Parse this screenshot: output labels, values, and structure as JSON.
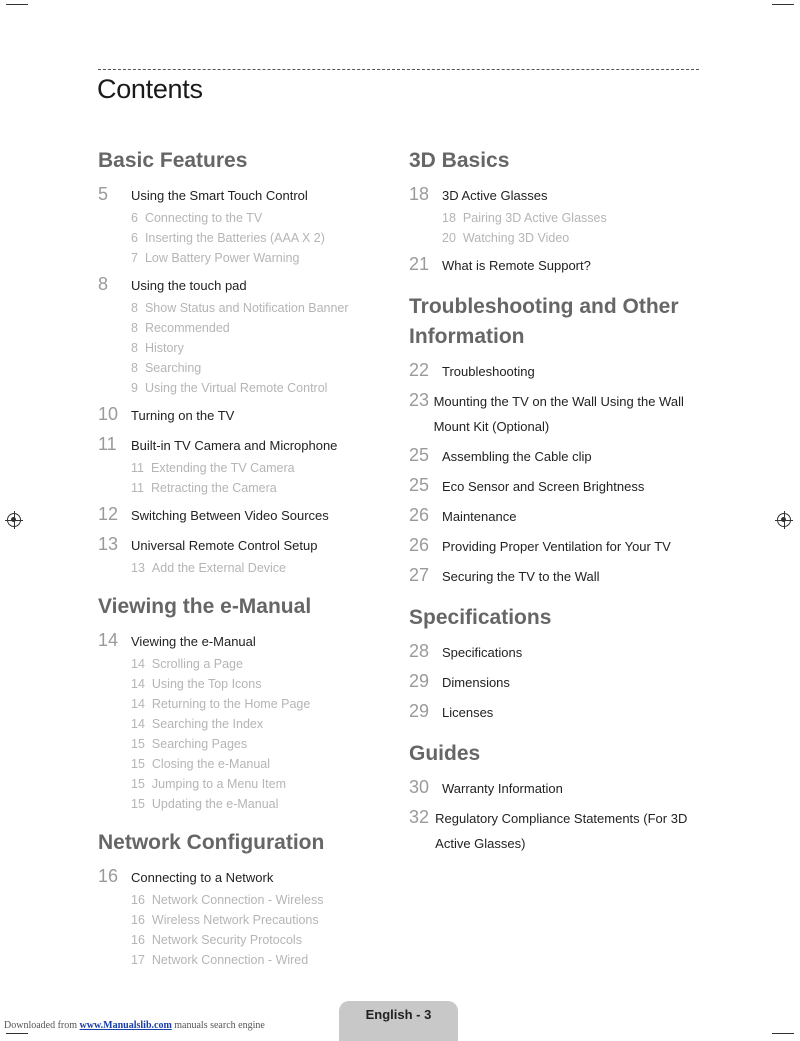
{
  "page": {
    "title": "Contents",
    "footer": {
      "downloaded_prefix": "Downloaded from",
      "link_text": "www.Manualslib.com",
      "suffix": "manuals search engine",
      "page_label": "English - 3"
    }
  },
  "left": [
    {
      "heading": "Basic Features",
      "entries": [
        {
          "num": "5",
          "label": "Using the Smart Touch Control",
          "subs": [
            {
              "num": "6",
              "label": "Connecting to the TV"
            },
            {
              "num": "6",
              "label": "Inserting the Batteries (AAA X 2)"
            },
            {
              "num": "7",
              "label": "Low Battery Power Warning"
            }
          ]
        },
        {
          "num": "8",
          "label": "Using the touch pad",
          "subs": [
            {
              "num": "8",
              "label": "Show Status and Notification Banner"
            },
            {
              "num": "8",
              "label": "Recommended"
            },
            {
              "num": "8",
              "label": "History"
            },
            {
              "num": "8",
              "label": "Searching"
            },
            {
              "num": "9",
              "label": "Using the Virtual Remote Control"
            }
          ]
        },
        {
          "num": "10",
          "label": "Turning on the TV",
          "subs": []
        },
        {
          "num": "11",
          "label": "Built-in TV Camera and Microphone",
          "subs": [
            {
              "num": "11",
              "label": "Extending the TV Camera"
            },
            {
              "num": "11",
              "label": "Retracting the Camera"
            }
          ]
        },
        {
          "num": "12",
          "label": "Switching Between Video Sources",
          "subs": []
        },
        {
          "num": "13",
          "label": "Universal Remote Control Setup",
          "subs": [
            {
              "num": "13",
              "label": "Add the External Device"
            }
          ]
        }
      ]
    },
    {
      "heading": "Viewing the e-Manual",
      "entries": [
        {
          "num": "14",
          "label": "Viewing the e-Manual",
          "subs": [
            {
              "num": "14",
              "label": "Scrolling a Page"
            },
            {
              "num": "14",
              "label": "Using the Top Icons"
            },
            {
              "num": "14",
              "label": "Returning to the Home Page"
            },
            {
              "num": "14",
              "label": "Searching the Index"
            },
            {
              "num": "15",
              "label": "Searching Pages"
            },
            {
              "num": "15",
              "label": "Closing the e-Manual"
            },
            {
              "num": "15",
              "label": "Jumping to a Menu Item"
            },
            {
              "num": "15",
              "label": "Updating the e-Manual"
            }
          ]
        }
      ]
    },
    {
      "heading": "Network Configuration",
      "entries": [
        {
          "num": "16",
          "label": "Connecting to a Network",
          "subs": [
            {
              "num": "16",
              "label": "Network Connection - Wireless"
            },
            {
              "num": "16",
              "label": "Wireless Network Precautions"
            },
            {
              "num": "16",
              "label": "Network Security Protocols"
            },
            {
              "num": "17",
              "label": "Network Connection - Wired"
            }
          ]
        }
      ]
    }
  ],
  "right": [
    {
      "heading": "3D Basics",
      "entries": [
        {
          "num": "18",
          "label": "3D Active Glasses",
          "subs": [
            {
              "num": "18",
              "label": "Pairing 3D Active Glasses"
            },
            {
              "num": "20",
              "label": "Watching 3D Video"
            }
          ]
        },
        {
          "num": "21",
          "label": "What is Remote Support?",
          "subs": []
        }
      ]
    },
    {
      "heading": "Troubleshooting and Other Information",
      "entries": [
        {
          "num": "22",
          "label": "Troubleshooting",
          "subs": []
        },
        {
          "num": "23",
          "label": "Mounting the TV on the Wall Using the Wall Mount Kit (Optional)",
          "subs": []
        },
        {
          "num": "25",
          "label": "Assembling the Cable clip",
          "subs": []
        },
        {
          "num": "25",
          "label": "Eco Sensor and Screen Brightness",
          "subs": []
        },
        {
          "num": "26",
          "label": "Maintenance",
          "subs": []
        },
        {
          "num": "26",
          "label": "Providing Proper Ventilation for Your TV",
          "subs": []
        },
        {
          "num": "27",
          "label": "Securing the TV to the Wall",
          "subs": []
        }
      ]
    },
    {
      "heading": "Specifications",
      "entries": [
        {
          "num": "28",
          "label": "Specifications",
          "subs": []
        },
        {
          "num": "29",
          "label": "Dimensions",
          "subs": []
        },
        {
          "num": "29",
          "label": "Licenses",
          "subs": []
        }
      ]
    },
    {
      "heading": "Guides",
      "entries": [
        {
          "num": "30",
          "label": "Warranty Information",
          "subs": []
        },
        {
          "num": "32",
          "label": "Regulatory Compliance Statements (For 3D Active Glasses)",
          "subs": []
        }
      ]
    }
  ]
}
